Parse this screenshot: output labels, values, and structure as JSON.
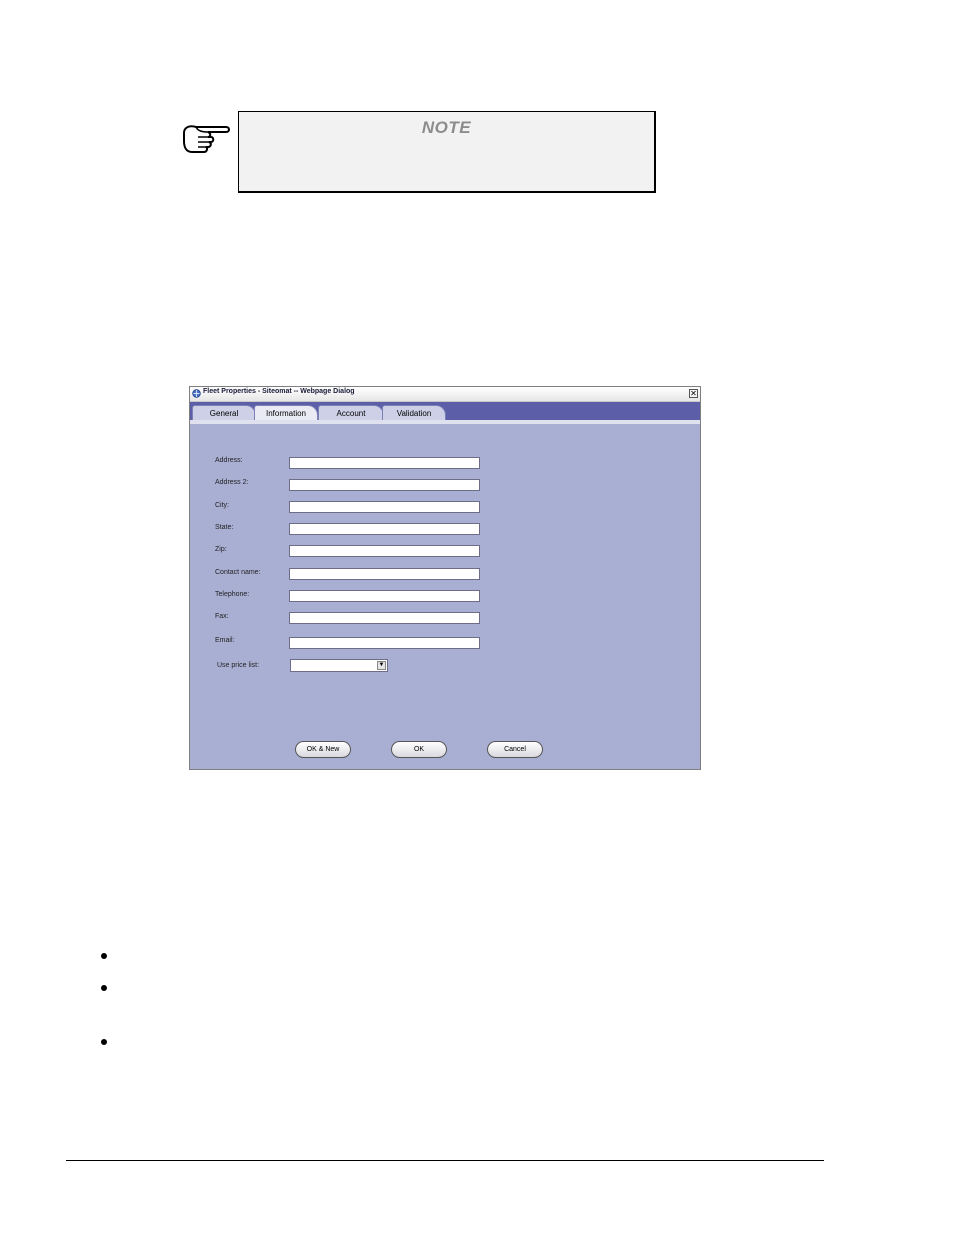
{
  "note": {
    "title": "NOTE",
    "icon": "pointing-hand-icon"
  },
  "dialog": {
    "title": "Fleet Properties - Siteomat -- Webpage Dialog",
    "tabs": [
      {
        "label": "General",
        "active": false
      },
      {
        "label": "Information",
        "active": true
      },
      {
        "label": "Account",
        "active": false
      },
      {
        "label": "Validation",
        "active": false
      }
    ],
    "fields": [
      {
        "label": "Address:",
        "value": ""
      },
      {
        "label": "Address 2:",
        "value": ""
      },
      {
        "label": "City:",
        "value": ""
      },
      {
        "label": "State:",
        "value": ""
      },
      {
        "label": "Zip:",
        "value": ""
      },
      {
        "label": "Contact name:",
        "value": ""
      },
      {
        "label": "Telephone:",
        "value": ""
      },
      {
        "label": "Fax:",
        "value": ""
      },
      {
        "label": "Email:",
        "value": ""
      }
    ],
    "price_list": {
      "label": "Use price list:",
      "selected": ""
    },
    "buttons": {
      "ok_new": "OK & New",
      "ok": "OK",
      "cancel": "Cancel"
    },
    "colors": {
      "body": "#a9afd3",
      "tabstrip": "#5c5fa8"
    }
  }
}
